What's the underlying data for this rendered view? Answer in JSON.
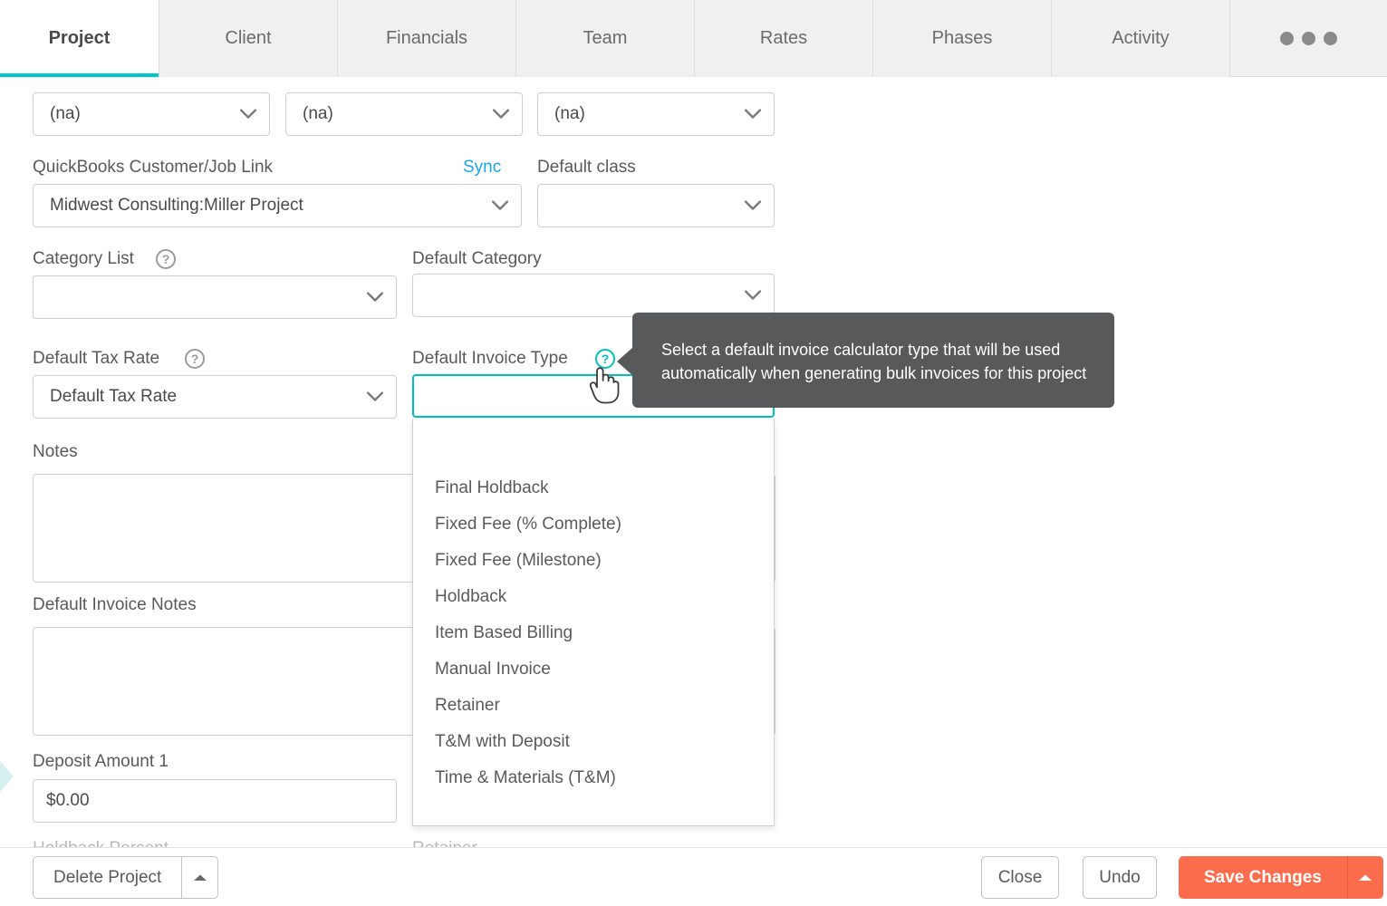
{
  "tabs": [
    {
      "label": "Project",
      "active": true
    },
    {
      "label": "Client",
      "active": false
    },
    {
      "label": "Financials",
      "active": false
    },
    {
      "label": "Team",
      "active": false
    },
    {
      "label": "Rates",
      "active": false
    },
    {
      "label": "Phases",
      "active": false
    },
    {
      "label": "Activity",
      "active": false
    }
  ],
  "overflow_menu_icon": "ellipsis-icon",
  "form": {
    "top_selects": [
      {
        "value": "(na)"
      },
      {
        "value": "(na)"
      },
      {
        "value": "(na)"
      }
    ],
    "quickbooks_label": "QuickBooks Customer/Job Link",
    "sync_link": "Sync",
    "quickbooks_value": "Midwest Consulting:Miller Project",
    "default_class_label": "Default class",
    "default_class_value": "",
    "category_list_label": "Category List",
    "category_list_value": "",
    "default_category_label": "Default Category",
    "default_category_value": "",
    "default_tax_rate_label": "Default Tax Rate",
    "default_tax_rate_value": "Default Tax Rate",
    "default_invoice_type_label": "Default Invoice Type",
    "default_invoice_type_value": "",
    "notes_label": "Notes",
    "notes_value": "",
    "default_invoice_notes_label": "Default Invoice Notes",
    "default_invoice_notes_value": "",
    "deposit_amount_label": "Deposit Amount 1",
    "deposit_amount_value": "$0.00",
    "cut_label_left": "Holdback Percent",
    "cut_label_right": "Retainer"
  },
  "tooltip": {
    "text": "Select a default invoice calculator type that will be used automatically when generating bulk invoices for this project"
  },
  "dropdown": {
    "options": [
      "Final Holdback",
      "Fixed Fee (% Complete)",
      "Fixed Fee (Milestone)",
      "Holdback",
      "Item Based Billing",
      "Manual Invoice",
      "Retainer",
      "T&M with Deposit",
      "Time & Materials (T&M)"
    ]
  },
  "footer": {
    "delete_label": "Delete Project",
    "close_label": "Close",
    "undo_label": "Undo",
    "save_label": "Save Changes"
  },
  "colors": {
    "accent_teal": "#00c9cc",
    "link_blue": "#15a8f0",
    "primary_orange": "#fb6d4c",
    "tooltip_bg": "#58595a"
  }
}
